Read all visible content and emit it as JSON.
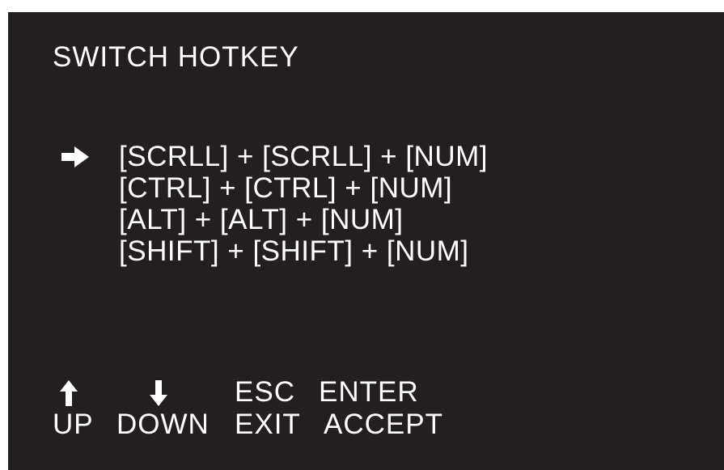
{
  "screen": {
    "title": "SWITCH HOTKEY",
    "background_color": "#231f20",
    "text_color": "#ffffff"
  },
  "menu": {
    "selected_index": 0,
    "cursor_icon": "right-arrow-icon",
    "items": [
      {
        "label": "[SCRLL] + [SCRLL] + [NUM]"
      },
      {
        "label": "[CTRL] + [CTRL] + [NUM]"
      },
      {
        "label": "[ALT] + [ALT] + [NUM]"
      },
      {
        "label": "[SHIFT] + [SHIFT] + [NUM]"
      }
    ]
  },
  "keys": {
    "up": {
      "icon": "up-arrow-icon",
      "label": "UP"
    },
    "down": {
      "icon": "down-arrow-icon",
      "label": "DOWN"
    },
    "esc": {
      "key": "ESC",
      "label": "EXIT"
    },
    "enter": {
      "key": "ENTER",
      "label": "ACCEPT"
    }
  }
}
